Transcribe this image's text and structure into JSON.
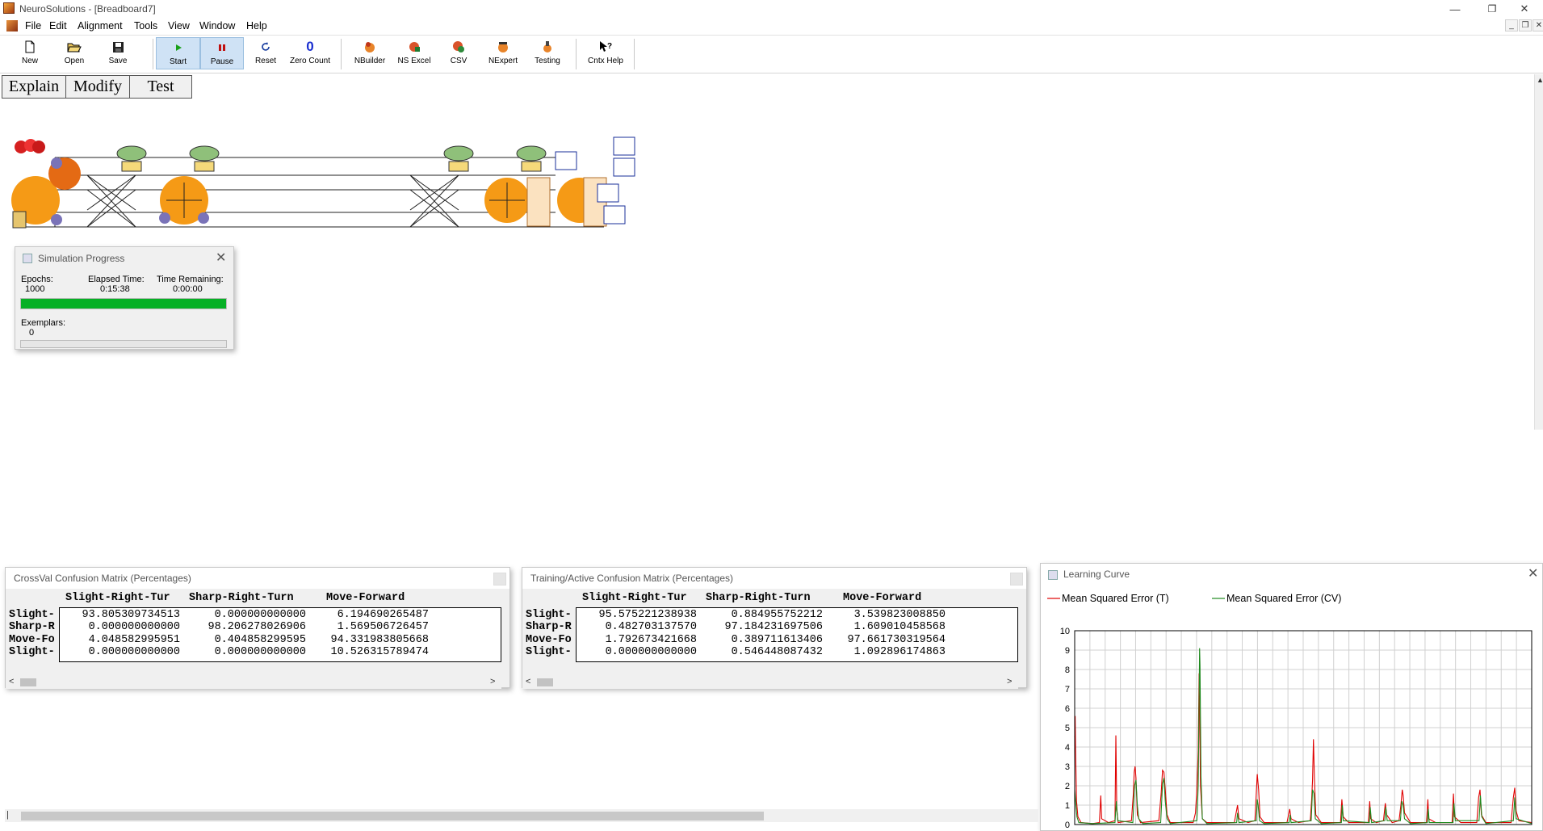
{
  "window": {
    "title": "NeuroSolutions - [Breadboard7]",
    "min": "—",
    "restore": "❐",
    "close": "✕"
  },
  "menu": [
    "File",
    "Edit",
    "Alignment",
    "Tools",
    "View",
    "Window",
    "Help"
  ],
  "mdi_controls": {
    "min": "_",
    "restore": "❐",
    "close": "✕"
  },
  "toolbar": {
    "new": "New",
    "open": "Open",
    "save": "Save",
    "start": "Start",
    "pause": "Pause",
    "reset": "Reset",
    "zero_count": "Zero Count",
    "nbuilder": "NBuilder",
    "ns_excel": "NS Excel",
    "csv": "CSV",
    "nexpert": "NExpert",
    "testing": "Testing",
    "cntx_help": "Cntx Help"
  },
  "tabs": [
    "Explain",
    "Modify",
    "Test"
  ],
  "sim_progress": {
    "title": "Simulation Progress",
    "epochs_label": "Epochs:",
    "epochs": "1000",
    "elapsed_label": "Elapsed Time:",
    "elapsed": "0:15:38",
    "remaining_label": "Time Remaining:",
    "remaining": "0:00:00",
    "epoch_progress": 1.0,
    "exemplars_label": "Exemplars:",
    "exemplars": "0",
    "exemplar_progress": 0.0
  },
  "crossval": {
    "title": "CrossVal Confusion Matrix (Percentages)",
    "headers": [
      "Slight-Right-Tur",
      "Sharp-Right-Turn",
      "Move-Forward"
    ],
    "rows": [
      {
        "label": "Slight-",
        "values": [
          "93.805309734513",
          "0.000000000000",
          "6.194690265487"
        ]
      },
      {
        "label": "Sharp-R",
        "values": [
          "0.000000000000",
          "98.206278026906",
          "1.569506726457"
        ]
      },
      {
        "label": "Move-Fo",
        "values": [
          "4.048582995951",
          "0.404858299595",
          "94.331983805668"
        ]
      },
      {
        "label": "Slight-",
        "values": [
          "0.000000000000",
          "0.000000000000",
          "10.526315789474"
        ]
      }
    ]
  },
  "training": {
    "title": "Training/Active Confusion Matrix (Percentages)",
    "headers": [
      "Slight-Right-Tur",
      "Sharp-Right-Turn",
      "Move-Forward"
    ],
    "rows": [
      {
        "label": "Slight-",
        "values": [
          "95.575221238938",
          "0.884955752212",
          "3.539823008850"
        ]
      },
      {
        "label": "Sharp-R",
        "values": [
          "0.482703137570",
          "97.184231697506",
          "1.609010458568"
        ]
      },
      {
        "label": "Move-Fo",
        "values": [
          "1.792673421668",
          "0.389711613406",
          "97.661730319564"
        ]
      },
      {
        "label": "Slight-",
        "values": [
          "0.000000000000",
          "0.546448087432",
          "1.092896174863"
        ]
      }
    ]
  },
  "learning_curve": {
    "title": "Learning Curve",
    "colors": {
      "t": "#e00000",
      "cv": "#1f8a1f",
      "grid": "#d0d0d0"
    },
    "chart_data": {
      "type": "line",
      "series": [
        {
          "name": "Mean Squared Error (T)",
          "points": [
            [
              1,
              4.5
            ],
            [
              2,
              5.6
            ],
            [
              3,
              3.8
            ],
            [
              5,
              1.2
            ],
            [
              8,
              0.4
            ],
            [
              15,
              0.1
            ],
            [
              40,
              0.05
            ],
            [
              55,
              0.1
            ],
            [
              58,
              1.5
            ],
            [
              60,
              0.3
            ],
            [
              75,
              0.1
            ],
            [
              89,
              0.2
            ],
            [
              91,
              4.6
            ],
            [
              93,
              0.8
            ],
            [
              96,
              0.1
            ],
            [
              125,
              0.2
            ],
            [
              129,
              1.5
            ],
            [
              131,
              2.7
            ],
            [
              133,
              3.0
            ],
            [
              135,
              2.4
            ],
            [
              138,
              0.5
            ],
            [
              145,
              0.1
            ],
            [
              185,
              0.2
            ],
            [
              190,
              1.6
            ],
            [
              193,
              2.8
            ],
            [
              196,
              2.7
            ],
            [
              199,
              1.8
            ],
            [
              203,
              0.5
            ],
            [
              210,
              0.1
            ],
            [
              260,
              0.1
            ],
            [
              265,
              0.6
            ],
            [
              268,
              1.8
            ],
            [
              271,
              3.8
            ],
            [
              273,
              7.8
            ],
            [
              276,
              2.0
            ],
            [
              280,
              0.3
            ],
            [
              290,
              0.1
            ],
            [
              350,
              0.1
            ],
            [
              357,
              1.0
            ],
            [
              360,
              0.3
            ],
            [
              380,
              0.1
            ],
            [
              395,
              0.2
            ],
            [
              400,
              2.6
            ],
            [
              403,
              1.8
            ],
            [
              406,
              0.4
            ],
            [
              415,
              0.1
            ],
            [
              465,
              0.1
            ],
            [
              471,
              0.8
            ],
            [
              474,
              0.3
            ],
            [
              490,
              0.1
            ],
            [
              516,
              0.2
            ],
            [
              519,
              1.3
            ],
            [
              521,
              2.3
            ],
            [
              523,
              4.4
            ],
            [
              525,
              2.4
            ],
            [
              528,
              0.5
            ],
            [
              540,
              0.1
            ],
            [
              582,
              0.1
            ],
            [
              585,
              1.3
            ],
            [
              588,
              0.4
            ],
            [
              600,
              0.1
            ],
            [
              643,
              0.1
            ],
            [
              646,
              1.2
            ],
            [
              648,
              0.3
            ],
            [
              660,
              0.1
            ],
            [
              676,
              0.2
            ],
            [
              680,
              1.1
            ],
            [
              683,
              0.5
            ],
            [
              695,
              0.1
            ],
            [
              710,
              0.2
            ],
            [
              714,
              1.0
            ],
            [
              717,
              1.8
            ],
            [
              719,
              1.5
            ],
            [
              722,
              0.6
            ],
            [
              735,
              0.1
            ],
            [
              770,
              0.1
            ],
            [
              773,
              1.3
            ],
            [
              775,
              0.3
            ],
            [
              790,
              0.1
            ],
            [
              826,
              0.1
            ],
            [
              829,
              1.6
            ],
            [
              831,
              0.4
            ],
            [
              845,
              0.1
            ],
            [
              880,
              0.1
            ],
            [
              884,
              1.4
            ],
            [
              887,
              1.8
            ],
            [
              890,
              0.5
            ],
            [
              900,
              0.1
            ],
            [
              955,
              0.1
            ],
            [
              960,
              1.4
            ],
            [
              963,
              1.9
            ],
            [
              966,
              0.7
            ],
            [
              972,
              0.2
            ],
            [
              1000,
              0.1
            ]
          ]
        },
        {
          "name": "Mean Squared Error (CV)",
          "points": [
            [
              1,
              1.8
            ],
            [
              3,
              1.2
            ],
            [
              6,
              0.4
            ],
            [
              10,
              0.1
            ],
            [
              40,
              0.05
            ],
            [
              89,
              0.1
            ],
            [
              92,
              1.2
            ],
            [
              95,
              0.2
            ],
            [
              128,
              0.1
            ],
            [
              132,
              2.0
            ],
            [
              135,
              2.3
            ],
            [
              138,
              1.0
            ],
            [
              141,
              0.3
            ],
            [
              150,
              0.05
            ],
            [
              189,
              0.1
            ],
            [
              193,
              2.1
            ],
            [
              196,
              2.4
            ],
            [
              199,
              1.2
            ],
            [
              203,
              0.3
            ],
            [
              210,
              0.05
            ],
            [
              268,
              0.2
            ],
            [
              271,
              2.0
            ],
            [
              273,
              6.5
            ],
            [
              274,
              9.1
            ],
            [
              275,
              8.2
            ],
            [
              277,
              2.5
            ],
            [
              280,
              0.3
            ],
            [
              290,
              0.05
            ],
            [
              355,
              0.1
            ],
            [
              357,
              0.6
            ],
            [
              360,
              0.1
            ],
            [
              398,
              0.2
            ],
            [
              400,
              1.3
            ],
            [
              402,
              1.0
            ],
            [
              405,
              0.2
            ],
            [
              415,
              0.05
            ],
            [
              470,
              0.1
            ],
            [
              472,
              0.5
            ],
            [
              474,
              0.1
            ],
            [
              518,
              0.2
            ],
            [
              521,
              1.8
            ],
            [
              524,
              1.6
            ],
            [
              527,
              0.3
            ],
            [
              540,
              0.05
            ],
            [
              584,
              0.1
            ],
            [
              586,
              1.0
            ],
            [
              588,
              0.2
            ],
            [
              645,
              0.1
            ],
            [
              647,
              0.9
            ],
            [
              650,
              0.1
            ],
            [
              679,
              0.2
            ],
            [
              681,
              0.9
            ],
            [
              684,
              0.2
            ],
            [
              713,
              0.2
            ],
            [
              716,
              1.2
            ],
            [
              719,
              1.0
            ],
            [
              722,
              0.3
            ],
            [
              735,
              0.05
            ],
            [
              772,
              0.1
            ],
            [
              774,
              0.8
            ],
            [
              776,
              0.1
            ],
            [
              828,
              0.1
            ],
            [
              830,
              1.1
            ],
            [
              833,
              0.2
            ],
            [
              885,
              0.2
            ],
            [
              888,
              1.5
            ],
            [
              891,
              0.4
            ],
            [
              900,
              0.05
            ],
            [
              960,
              0.2
            ],
            [
              963,
              1.4
            ],
            [
              966,
              0.3
            ],
            [
              1000,
              0.05
            ]
          ]
        }
      ],
      "ylim": [
        0,
        10
      ],
      "xlim": [
        1,
        1000
      ],
      "yticks": [
        "0",
        "1",
        "2",
        "3",
        "4",
        "5",
        "6",
        "7",
        "8",
        "9",
        "10"
      ],
      "xticks": [
        "1",
        "61",
        "121",
        "181",
        "241",
        "301",
        "361",
        "421",
        "481",
        "541",
        "601",
        "661",
        "721",
        "781",
        "841",
        "901",
        "961"
      ],
      "grid": true,
      "legend_position": "top"
    }
  }
}
